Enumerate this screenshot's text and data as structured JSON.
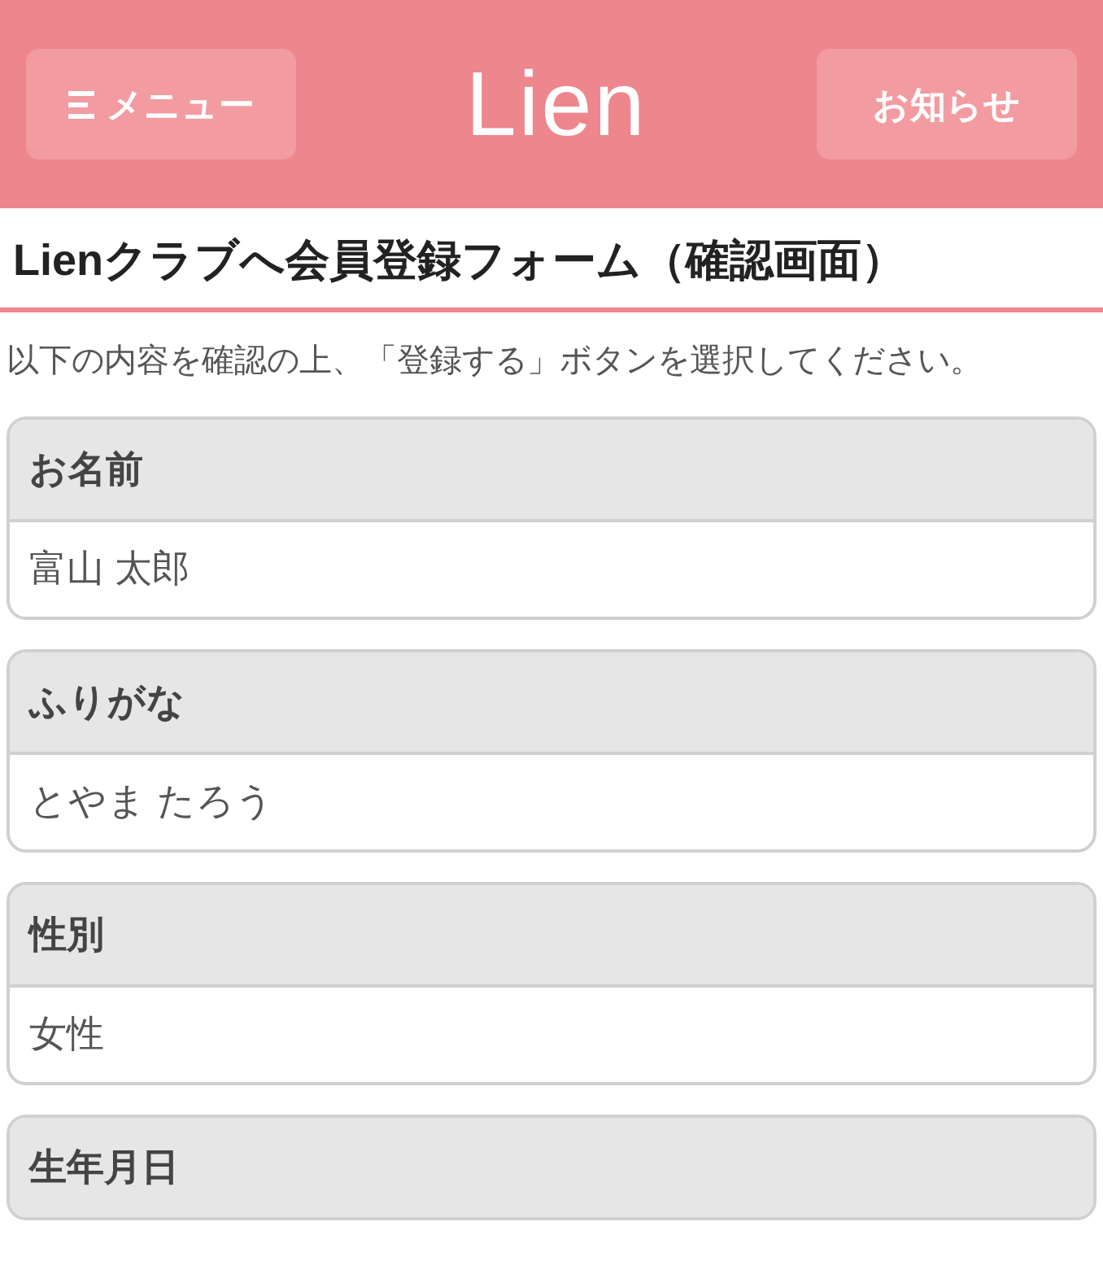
{
  "header": {
    "menu_button": "メニュー",
    "logo": "Lien",
    "news_button": "お知らせ"
  },
  "page_title": "Lienクラブへ会員登録フォーム（確認画面）",
  "instructions": "以下の内容を確認の上、「登録する」ボタンを選択してください。",
  "fields": [
    {
      "label": "お名前",
      "value": "富山 太郎"
    },
    {
      "label": "ふりがな",
      "value": "とやま たろう"
    },
    {
      "label": "性別",
      "value": "女性"
    },
    {
      "label": "生年月日"
    }
  ]
}
